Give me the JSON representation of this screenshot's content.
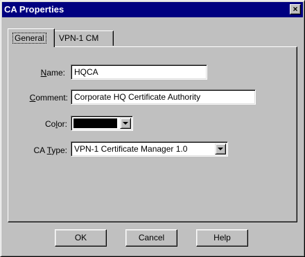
{
  "window": {
    "title": "CA Properties",
    "close_glyph": "×"
  },
  "tabs": [
    {
      "label": "General",
      "active": true
    },
    {
      "label": "VPN-1 CM",
      "active": false
    }
  ],
  "form": {
    "name": {
      "label_pre": "",
      "label_key": "N",
      "label_post": "ame:",
      "value": "HQCA"
    },
    "comment": {
      "label_pre": "",
      "label_key": "C",
      "label_post": "omment:",
      "value": "Corporate HQ Certificate Authority"
    },
    "color": {
      "label_pre": "Co",
      "label_key": "l",
      "label_post": "or:",
      "value": "#000000"
    },
    "ca_type": {
      "label_pre": "CA ",
      "label_key": "T",
      "label_post": "ype:",
      "value": "VPN-1 Certificate Manager 1.0"
    }
  },
  "buttons": {
    "ok": "OK",
    "cancel": "Cancel",
    "help": "Help"
  },
  "colors": {
    "titlebar": "#000080",
    "face": "#c0c0c0"
  }
}
